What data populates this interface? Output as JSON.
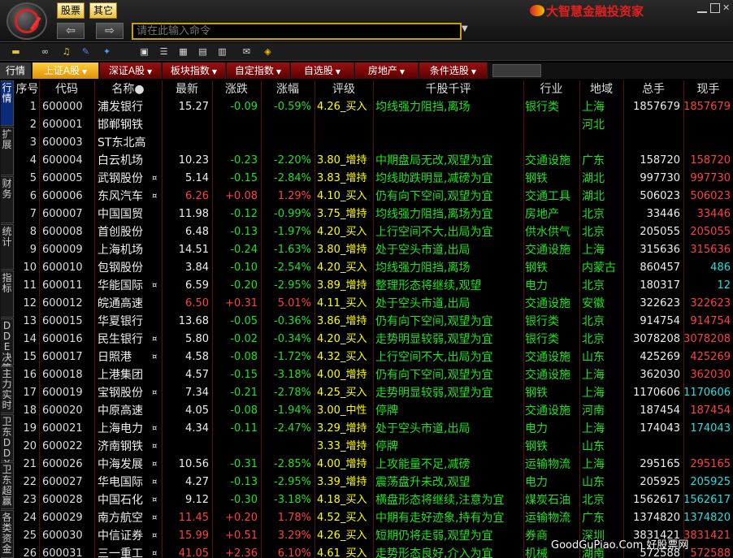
{
  "topbar": {
    "menus": [
      "股票",
      "其它"
    ],
    "command_placeholder": "请在此输入命令",
    "brand": "大智慧金融投资家"
  },
  "tabs": {
    "left_label": "行情",
    "items": [
      {
        "label": "上证A股",
        "active": true
      },
      {
        "label": "深证A股",
        "active": false
      },
      {
        "label": "板块指数",
        "active": false
      },
      {
        "label": "自定指数",
        "active": false
      },
      {
        "label": "自选股",
        "active": false
      },
      {
        "label": "房地产",
        "active": false
      },
      {
        "label": "条件选股",
        "active": false
      }
    ]
  },
  "sidebar": [
    {
      "label": "行情",
      "active": true
    },
    {
      "label": "扩展",
      "active": false
    },
    {
      "label": "财务",
      "active": false
    },
    {
      "label": "统计",
      "active": false
    },
    {
      "label": "指标",
      "active": false
    },
    {
      "label": "DDE决策",
      "active": false
    },
    {
      "label": "主力实时",
      "active": false
    },
    {
      "label": "卫东DDX",
      "active": false
    },
    {
      "label": "卫东超赢",
      "active": false
    },
    {
      "label": "各类资金",
      "active": false
    }
  ],
  "columns": [
    "序号",
    "代码",
    "名称●",
    "最新",
    "涨跌",
    "涨幅",
    "评级",
    "千股千评",
    "行业",
    "地域",
    "总手",
    "现手"
  ],
  "rows": [
    {
      "idx": "1",
      "code": "600000",
      "name": "浦发银行",
      "mark": "",
      "price": "15.27",
      "chg": "-0.09",
      "pct": "-0.59%",
      "rating": "4.26_买入",
      "comment": "均线强力阻挡,离场",
      "industry": "银行类",
      "region": "上海",
      "vol": "1857679",
      "cur": "1857679",
      "dir": "down",
      "cy": false
    },
    {
      "idx": "2",
      "code": "600001",
      "name": "邯郸钢铁",
      "mark": "",
      "price": "",
      "chg": "",
      "pct": "",
      "rating": "",
      "comment": "",
      "industry": "",
      "region": "河北",
      "vol": "",
      "cur": "",
      "dir": "flat",
      "cy": false
    },
    {
      "idx": "3",
      "code": "600003",
      "name": "ST东北高",
      "mark": "",
      "price": "",
      "chg": "",
      "pct": "",
      "rating": "",
      "comment": "",
      "industry": "",
      "region": "",
      "vol": "",
      "cur": "",
      "dir": "flat",
      "cy": false
    },
    {
      "idx": "4",
      "code": "600004",
      "name": "白云机场",
      "mark": "",
      "price": "10.23",
      "chg": "-0.23",
      "pct": "-2.20%",
      "rating": "3.80_增持",
      "comment": "中期盘局无改,观望为宜",
      "industry": "交通设施",
      "region": "广东",
      "vol": "158720",
      "cur": "158720",
      "dir": "down",
      "cy": false
    },
    {
      "idx": "5",
      "code": "600005",
      "name": "武钢股份",
      "mark": "¤",
      "price": "5.14",
      "chg": "-0.15",
      "pct": "-2.84%",
      "rating": "3.83_增持",
      "comment": "均线助跌明显,减磅为宜",
      "industry": "钢铁",
      "region": "湖北",
      "vol": "997730",
      "cur": "997730",
      "dir": "down",
      "cy": false
    },
    {
      "idx": "6",
      "code": "600006",
      "name": "东风汽车",
      "mark": "¤",
      "price": "6.26",
      "chg": "+0.08",
      "pct": "1.29%",
      "rating": "4.10_买入",
      "comment": "仍有向下空间,观望为宜",
      "industry": "交通工具",
      "region": "湖北",
      "vol": "506023",
      "cur": "506023",
      "dir": "up",
      "cy": false
    },
    {
      "idx": "7",
      "code": "600007",
      "name": "中国国贸",
      "mark": "",
      "price": "11.98",
      "chg": "-0.12",
      "pct": "-0.99%",
      "rating": "3.75_增持",
      "comment": "均线强力阻挡,离场为宜",
      "industry": "房地产",
      "region": "北京",
      "vol": "33446",
      "cur": "33446",
      "dir": "down",
      "cy": false
    },
    {
      "idx": "8",
      "code": "600008",
      "name": "首创股份",
      "mark": "",
      "price": "6.48",
      "chg": "-0.13",
      "pct": "-1.97%",
      "rating": "4.20_买入",
      "comment": "上行空间不大,出局为宜",
      "industry": "供水供气",
      "region": "北京",
      "vol": "205055",
      "cur": "205055",
      "dir": "down",
      "cy": false
    },
    {
      "idx": "9",
      "code": "600009",
      "name": "上海机场",
      "mark": "",
      "price": "14.51",
      "chg": "-0.24",
      "pct": "-1.63%",
      "rating": "3.80_增持",
      "comment": "处于空头市道,出局",
      "industry": "交通设施",
      "region": "上海",
      "vol": "315636",
      "cur": "315636",
      "dir": "down",
      "cy": false
    },
    {
      "idx": "10",
      "code": "600010",
      "name": "包钢股份",
      "mark": "",
      "price": "3.84",
      "chg": "-0.10",
      "pct": "-2.54%",
      "rating": "4.20_买入",
      "comment": "均线强力阻挡,离场",
      "industry": "钢铁",
      "region": "内蒙古",
      "vol": "860457",
      "cur": "486",
      "dir": "down",
      "cy": true
    },
    {
      "idx": "11",
      "code": "600011",
      "name": "华能国际",
      "mark": "¤",
      "price": "6.59",
      "chg": "-0.20",
      "pct": "-2.95%",
      "rating": "3.89_增持",
      "comment": "整理形态将继续,观望",
      "industry": "电力",
      "region": "北京",
      "vol": "180317",
      "cur": "12",
      "dir": "down",
      "cy": true
    },
    {
      "idx": "12",
      "code": "600012",
      "name": "皖通高速",
      "mark": "",
      "price": "6.50",
      "chg": "+0.31",
      "pct": "5.01%",
      "rating": "4.11_买入",
      "comment": "处于空头市道,出局",
      "industry": "交通设施",
      "region": "安徽",
      "vol": "322623",
      "cur": "322623",
      "dir": "up",
      "cy": false
    },
    {
      "idx": "13",
      "code": "600015",
      "name": "华夏银行",
      "mark": "",
      "price": "13.68",
      "chg": "-0.05",
      "pct": "-0.36%",
      "rating": "3.86_增持",
      "comment": "仍有向下空间,观望为宜",
      "industry": "银行类",
      "region": "北京",
      "vol": "914754",
      "cur": "914754",
      "dir": "down",
      "cy": false
    },
    {
      "idx": "14",
      "code": "600016",
      "name": "民生银行",
      "mark": "¤",
      "price": "5.80",
      "chg": "-0.02",
      "pct": "-0.34%",
      "rating": "4.20_买入",
      "comment": "走势明显较弱,观望为宜",
      "industry": "银行类",
      "region": "北京",
      "vol": "3078208",
      "cur": "3078208",
      "dir": "down",
      "cy": false
    },
    {
      "idx": "15",
      "code": "600017",
      "name": "日照港",
      "mark": "¤",
      "price": "4.58",
      "chg": "-0.08",
      "pct": "-1.72%",
      "rating": "4.32_买入",
      "comment": "上行空间不大,出局为宜",
      "industry": "交通设施",
      "region": "山东",
      "vol": "425269",
      "cur": "425269",
      "dir": "down",
      "cy": false
    },
    {
      "idx": "16",
      "code": "600018",
      "name": "上港集团",
      "mark": "",
      "price": "4.57",
      "chg": "-0.15",
      "pct": "-3.18%",
      "rating": "4.00_增持",
      "comment": "仍有向下空间,观望为宜",
      "industry": "交通设施",
      "region": "上海",
      "vol": "362030",
      "cur": "362030",
      "dir": "down",
      "cy": false
    },
    {
      "idx": "17",
      "code": "600019",
      "name": "宝钢股份",
      "mark": "¤",
      "price": "7.34",
      "chg": "-0.21",
      "pct": "-2.78%",
      "rating": "4.25_买入",
      "comment": "走势明显较弱,观望为宜",
      "industry": "钢铁",
      "region": "上海",
      "vol": "1170606",
      "cur": "1170606",
      "dir": "down",
      "cy": true
    },
    {
      "idx": "18",
      "code": "600020",
      "name": "中原高速",
      "mark": "",
      "price": "4.05",
      "chg": "-0.08",
      "pct": "-1.94%",
      "rating": "3.00_中性",
      "comment": "停牌",
      "industry": "交通设施",
      "region": "河南",
      "vol": "187454",
      "cur": "187454",
      "dir": "down",
      "cy": false
    },
    {
      "idx": "19",
      "code": "600021",
      "name": "上海电力",
      "mark": "¤",
      "price": "4.34",
      "chg": "-0.11",
      "pct": "-2.47%",
      "rating": "3.29_增持",
      "comment": "处于空头市道,出局",
      "industry": "电力",
      "region": "上海",
      "vol": "174043",
      "cur": "174043",
      "dir": "down",
      "cy": true
    },
    {
      "idx": "20",
      "code": "600022",
      "name": "济南钢铁",
      "mark": "¤",
      "price": "",
      "chg": "",
      "pct": "",
      "rating": "3.33_增持",
      "comment": "停牌",
      "industry": "钢铁",
      "region": "山东",
      "vol": "",
      "cur": "",
      "dir": "flat",
      "cy": false
    },
    {
      "idx": "21",
      "code": "600026",
      "name": "中海发展",
      "mark": "¤",
      "price": "10.56",
      "chg": "-0.31",
      "pct": "-2.85%",
      "rating": "4.00_增持",
      "comment": "上攻能量不足,减磅",
      "industry": "运输物流",
      "region": "上海",
      "vol": "295165",
      "cur": "295165",
      "dir": "down",
      "cy": false
    },
    {
      "idx": "22",
      "code": "600027",
      "name": "华电国际",
      "mark": "¤",
      "price": "4.27",
      "chg": "-0.13",
      "pct": "-2.95%",
      "rating": "3.39_增持",
      "comment": "震荡盘升未改,观望",
      "industry": "电力",
      "region": "山东",
      "vol": "205925",
      "cur": "205925",
      "dir": "down",
      "cy": true
    },
    {
      "idx": "23",
      "code": "600028",
      "name": "中国石化",
      "mark": "¤",
      "price": "9.12",
      "chg": "-0.30",
      "pct": "-3.18%",
      "rating": "4.18_买入",
      "comment": "横盘形态将继续,注意为宜",
      "industry": "煤炭石油",
      "region": "北京",
      "vol": "1562617",
      "cur": "1562617",
      "dir": "down",
      "cy": true
    },
    {
      "idx": "24",
      "code": "600029",
      "name": "南方航空",
      "mark": "¤",
      "price": "11.45",
      "chg": "+0.20",
      "pct": "1.78%",
      "rating": "4.52_买入",
      "comment": "中期有走好迹象,持有为宜",
      "industry": "运输物流",
      "region": "广东",
      "vol": "1374820",
      "cur": "1374820",
      "dir": "up",
      "cy": true
    },
    {
      "idx": "25",
      "code": "600030",
      "name": "中信证券",
      "mark": "¤",
      "price": "15.99",
      "chg": "+0.51",
      "pct": "3.29%",
      "rating": "4.26_买入",
      "comment": "短期仍将走弱,观望为宜",
      "industry": "券商",
      "region": "深圳",
      "vol": "3831421",
      "cur": "3831421",
      "dir": "up",
      "cy": false
    },
    {
      "idx": "26",
      "code": "600031",
      "name": "三一重工",
      "mark": "¤",
      "price": "41.05",
      "chg": "+2.36",
      "pct": "6.10%",
      "rating": "4.61_买入",
      "comment": "走势形态良好,介入为宜",
      "industry": "机械",
      "region": "湖南",
      "vol": "572588",
      "cur": "572588",
      "dir": "up",
      "cy": false
    }
  ],
  "watermark": "GoodGuPiao.Com 好股票网"
}
